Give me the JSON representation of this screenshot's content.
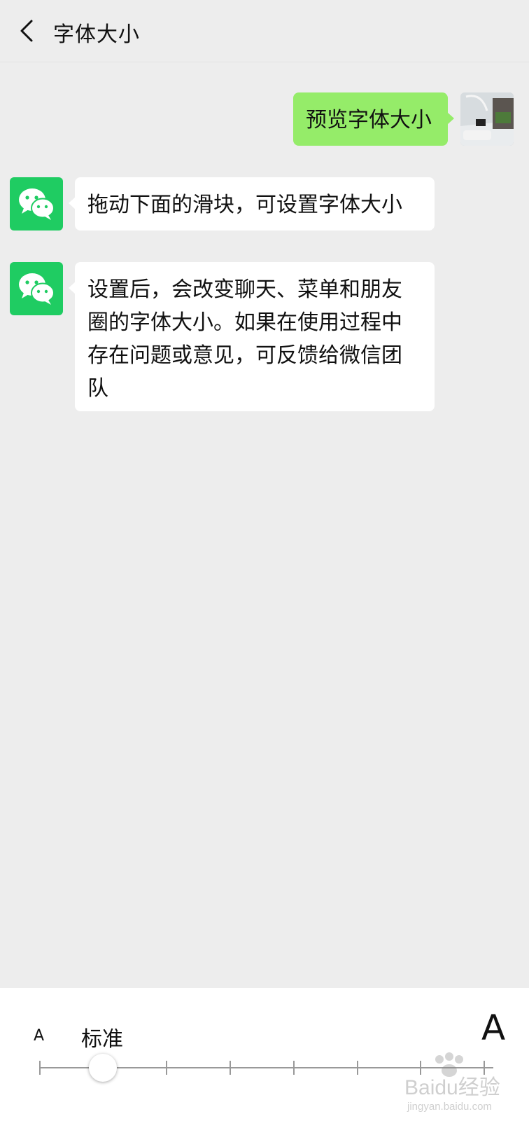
{
  "header": {
    "title": "字体大小"
  },
  "messages": [
    {
      "from": "me",
      "text": "预览字体大小"
    },
    {
      "from": "wechat",
      "text": "拖动下面的滑块，可设置字体大小"
    },
    {
      "from": "wechat",
      "text": "设置后，会改变聊天、菜单和朋友圈的字体大小。如果在使用过程中存在问题或意见，可反馈给微信团队"
    }
  ],
  "font_slider": {
    "min_label": "A",
    "max_label": "A",
    "current_label": "标准",
    "steps": 8,
    "current_step": 2
  },
  "watermark": {
    "text": "Baidu经验",
    "sub": "jingyan.baidu.com"
  },
  "colors": {
    "bg": "#ededed",
    "my_bubble": "#95ec69",
    "wechat_green": "#1fcc62"
  }
}
